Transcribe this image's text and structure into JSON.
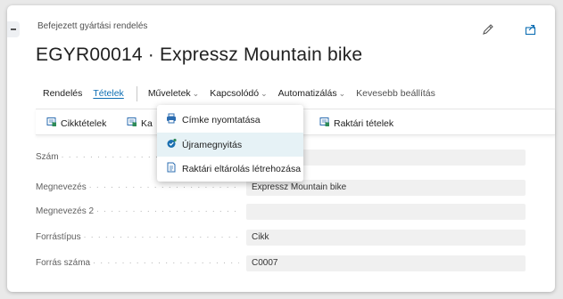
{
  "header": {
    "subtitle": "Befejezett gyártási rendelés",
    "title": "EGYR00014 · Expressz Mountain bike"
  },
  "tabs": [
    {
      "label": "Rendelés"
    },
    {
      "label": "Tételek"
    },
    {
      "label": "Műveletek"
    },
    {
      "label": "Kapcsolódó"
    },
    {
      "label": "Automatizálás"
    },
    {
      "label": "Kevesebb beállítás"
    }
  ],
  "actions": [
    {
      "label": "Cikktételek"
    },
    {
      "label": "Ka"
    },
    {
      "label": "Raktári tételek"
    }
  ],
  "menu": [
    {
      "label": "Címke nyomtatása"
    },
    {
      "label": "Újramegnyitás"
    },
    {
      "label": "Raktári eltárolás létrehozása"
    }
  ],
  "fields": [
    {
      "label": "Szám",
      "value": ""
    },
    {
      "label": "Megnevezés",
      "value": "Expressz Mountain bike"
    },
    {
      "label": "Megnevezés 2",
      "value": ""
    },
    {
      "label": "Forrástípus",
      "value": "Cikk"
    },
    {
      "label": "Forrás száma",
      "value": "C0007"
    }
  ],
  "icons": {
    "edit": "pencil-icon",
    "share": "share-icon"
  },
  "colors": {
    "accent": "#0d6eb3",
    "highlight": "#e6f2f6"
  }
}
